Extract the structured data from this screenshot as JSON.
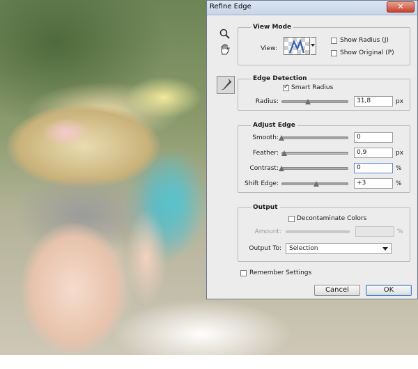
{
  "dialog": {
    "title": "Refine Edge",
    "close_glyph": "✕"
  },
  "tools": [
    "zoom-icon",
    "hand-icon",
    "refine-radius-brush-icon"
  ],
  "view_mode": {
    "title": "View Mode",
    "view_label": "View:",
    "show_radius": {
      "label": "Show Radius (J)",
      "checked": false
    },
    "show_original": {
      "label": "Show Original (P)",
      "checked": false
    }
  },
  "edge_detection": {
    "title": "Edge Detection",
    "smart_radius": {
      "label": "Smart Radius",
      "checked": true
    },
    "radius": {
      "label": "Radius:",
      "value": "31,8",
      "unit": "px",
      "level": 0.4
    }
  },
  "adjust_edge": {
    "title": "Adjust Edge",
    "smooth": {
      "label": "Smooth:",
      "value": "0",
      "unit": "",
      "level": 0.0
    },
    "feather": {
      "label": "Feather:",
      "value": "0,9",
      "unit": "px",
      "level": 0.04
    },
    "contrast": {
      "label": "Contrast:",
      "value": "0",
      "unit": "%",
      "level": 0.0
    },
    "shift_edge": {
      "label": "Shift Edge:",
      "value": "+3",
      "unit": "%",
      "level": 0.52
    }
  },
  "output": {
    "title": "Output",
    "decontaminate": {
      "label": "Decontaminate Colors",
      "checked": false
    },
    "amount": {
      "label": "Amount:",
      "value": "",
      "unit": "%"
    },
    "output_to": {
      "label": "Output To:",
      "selected": "Selection"
    }
  },
  "remember": {
    "label": "Remember Settings",
    "checked": false
  },
  "buttons": {
    "cancel": "Cancel",
    "ok": "OK"
  },
  "colors": {
    "title_bar": "#c5d4e6",
    "close_button": "#c8422b",
    "dialog_bg": "#ececec",
    "default_button_border": "#4a7fc1"
  }
}
